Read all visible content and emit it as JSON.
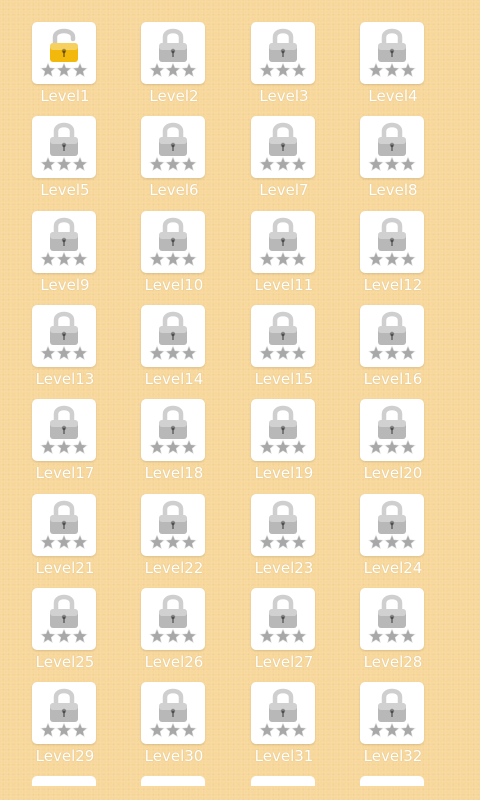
{
  "colors": {
    "background": "#f7d79a",
    "card": "#ffffff",
    "label": "#ffffff",
    "lock_locked": "#b8b8b8",
    "lock_unlocked": "#f2b90c",
    "star_empty": "#a8a8a8"
  },
  "icons": {
    "lock_locked": "padlock-closed-gray",
    "lock_unlocked": "padlock-open-gold",
    "star": "star-empty-gray"
  },
  "levels": [
    {
      "label": "Level1",
      "unlocked": true,
      "stars": 0
    },
    {
      "label": "Level2",
      "unlocked": false,
      "stars": 0
    },
    {
      "label": "Level3",
      "unlocked": false,
      "stars": 0
    },
    {
      "label": "Level4",
      "unlocked": false,
      "stars": 0
    },
    {
      "label": "Level5",
      "unlocked": false,
      "stars": 0
    },
    {
      "label": "Level6",
      "unlocked": false,
      "stars": 0
    },
    {
      "label": "Level7",
      "unlocked": false,
      "stars": 0
    },
    {
      "label": "Level8",
      "unlocked": false,
      "stars": 0
    },
    {
      "label": "Level9",
      "unlocked": false,
      "stars": 0
    },
    {
      "label": "Level10",
      "unlocked": false,
      "stars": 0
    },
    {
      "label": "Level11",
      "unlocked": false,
      "stars": 0
    },
    {
      "label": "Level12",
      "unlocked": false,
      "stars": 0
    },
    {
      "label": "Level13",
      "unlocked": false,
      "stars": 0
    },
    {
      "label": "Level14",
      "unlocked": false,
      "stars": 0
    },
    {
      "label": "Level15",
      "unlocked": false,
      "stars": 0
    },
    {
      "label": "Level16",
      "unlocked": false,
      "stars": 0
    },
    {
      "label": "Level17",
      "unlocked": false,
      "stars": 0
    },
    {
      "label": "Level18",
      "unlocked": false,
      "stars": 0
    },
    {
      "label": "Level19",
      "unlocked": false,
      "stars": 0
    },
    {
      "label": "Level20",
      "unlocked": false,
      "stars": 0
    },
    {
      "label": "Level21",
      "unlocked": false,
      "stars": 0
    },
    {
      "label": "Level22",
      "unlocked": false,
      "stars": 0
    },
    {
      "label": "Level23",
      "unlocked": false,
      "stars": 0
    },
    {
      "label": "Level24",
      "unlocked": false,
      "stars": 0
    },
    {
      "label": "Level25",
      "unlocked": false,
      "stars": 0
    },
    {
      "label": "Level26",
      "unlocked": false,
      "stars": 0
    },
    {
      "label": "Level27",
      "unlocked": false,
      "stars": 0
    },
    {
      "label": "Level28",
      "unlocked": false,
      "stars": 0
    },
    {
      "label": "Level29",
      "unlocked": false,
      "stars": 0
    },
    {
      "label": "Level30",
      "unlocked": false,
      "stars": 0
    },
    {
      "label": "Level31",
      "unlocked": false,
      "stars": 0
    },
    {
      "label": "Level32",
      "unlocked": false,
      "stars": 0
    }
  ]
}
